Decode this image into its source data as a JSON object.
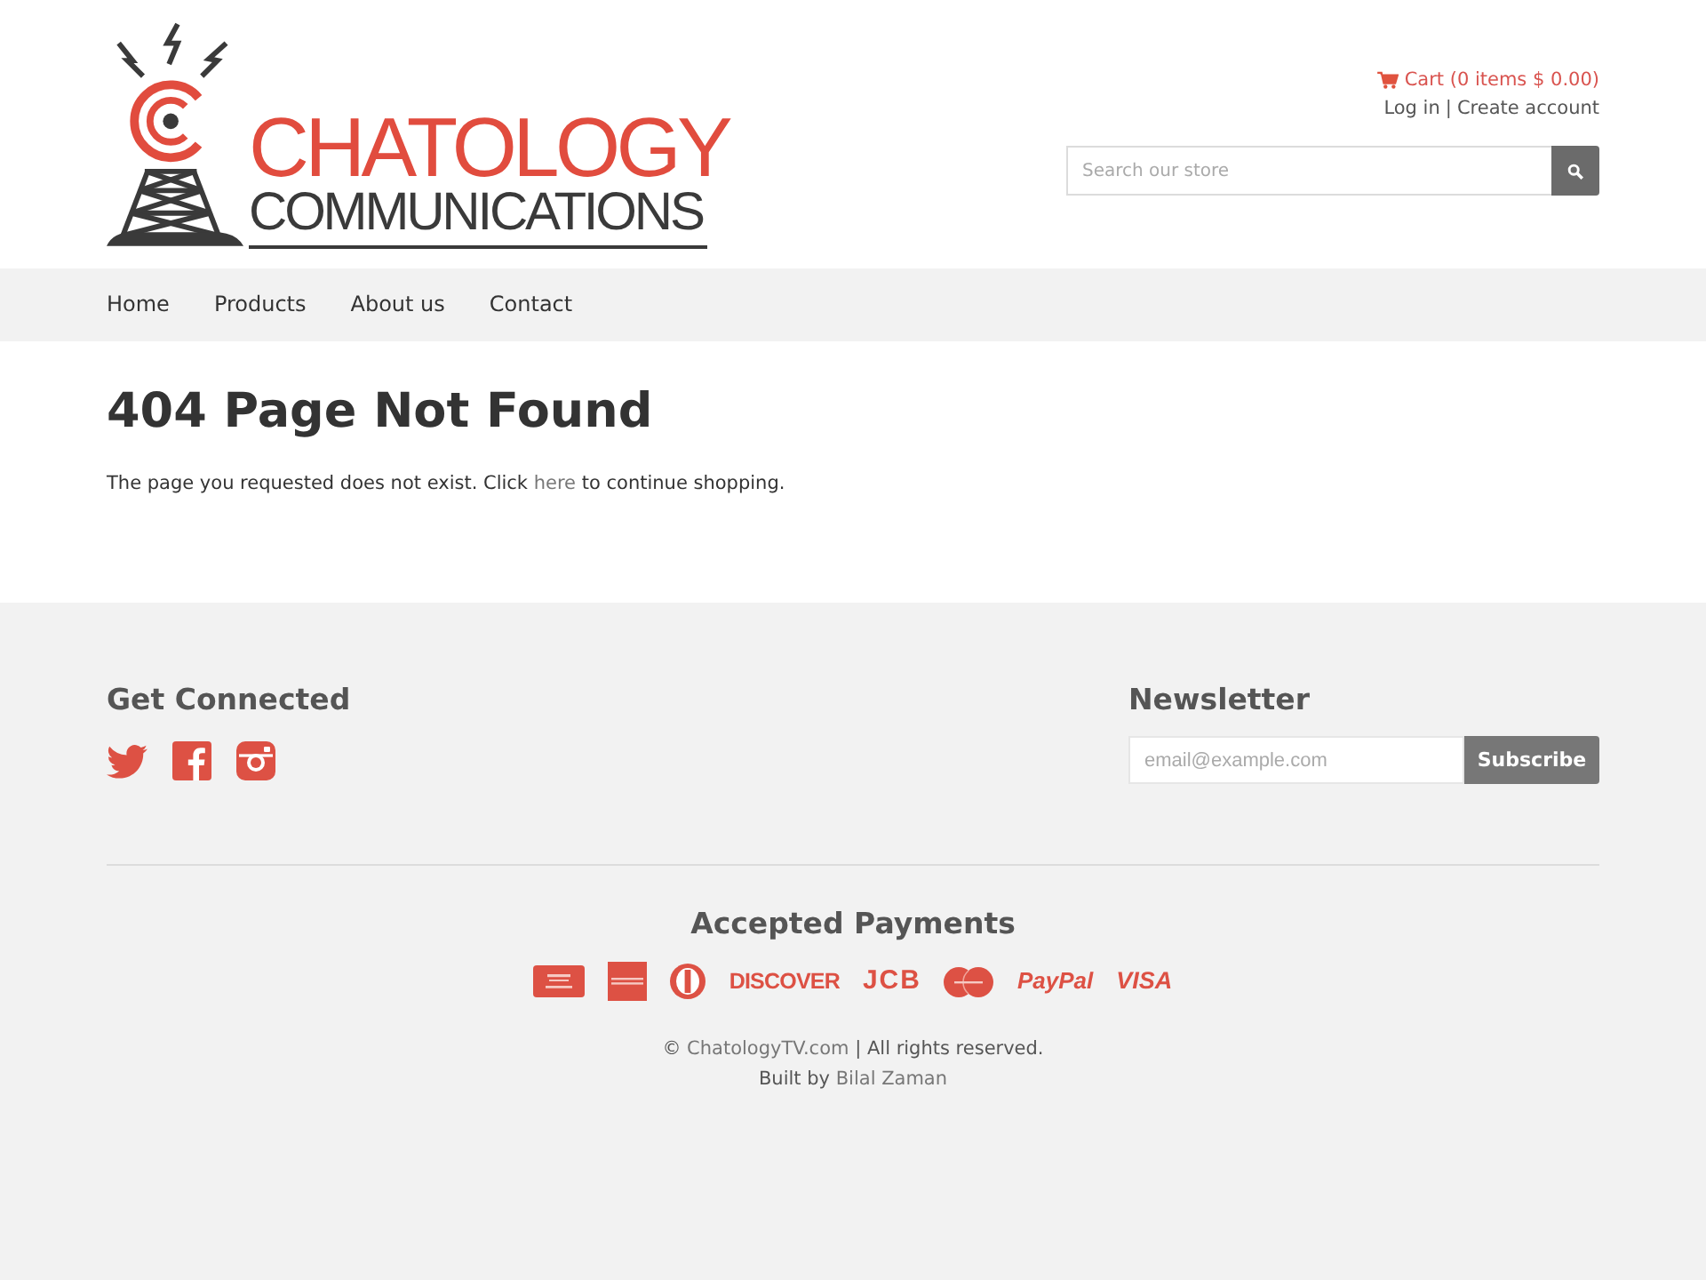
{
  "header": {
    "logo": {
      "name": "CHATOLOGY",
      "tagline": "COMMUNICATIONS"
    },
    "cart": "Cart (0 items $ 0.00)",
    "account": {
      "login": "Log in",
      "separator": "|",
      "signup": "Create account"
    },
    "search": {
      "placeholder": "Search our store"
    }
  },
  "nav": [
    {
      "label": "Home"
    },
    {
      "label": "Products"
    },
    {
      "label": "About us"
    },
    {
      "label": "Contact"
    }
  ],
  "page": {
    "title": "404 Page Not Found",
    "message": {
      "before": "The page you requested does not exist. Click",
      "link": "here",
      "after": "to continue shopping."
    }
  },
  "footer": {
    "social": {
      "title": "Get Connected"
    },
    "newsletter": {
      "title": "Newsletter",
      "placeholder": "email@example.com",
      "button": "Subscribe"
    },
    "payments": {
      "title": "Accepted Payments",
      "methods": [
        {
          "kind": "amazon"
        },
        {
          "kind": "amex"
        },
        {
          "kind": "diners"
        },
        {
          "kind": "discover",
          "label": "DISCOVER"
        },
        {
          "kind": "jcb",
          "label": "JCB"
        },
        {
          "kind": "mastercard"
        },
        {
          "kind": "paypal",
          "label": "PayPal"
        },
        {
          "kind": "visa",
          "label": "VISA"
        }
      ]
    },
    "copyright": {
      "symbol": "©",
      "link": "ChatologyTV.com",
      "after": "| All rights reserved."
    },
    "credit": {
      "before": "Built by",
      "link": "Bilal Zaman"
    }
  }
}
